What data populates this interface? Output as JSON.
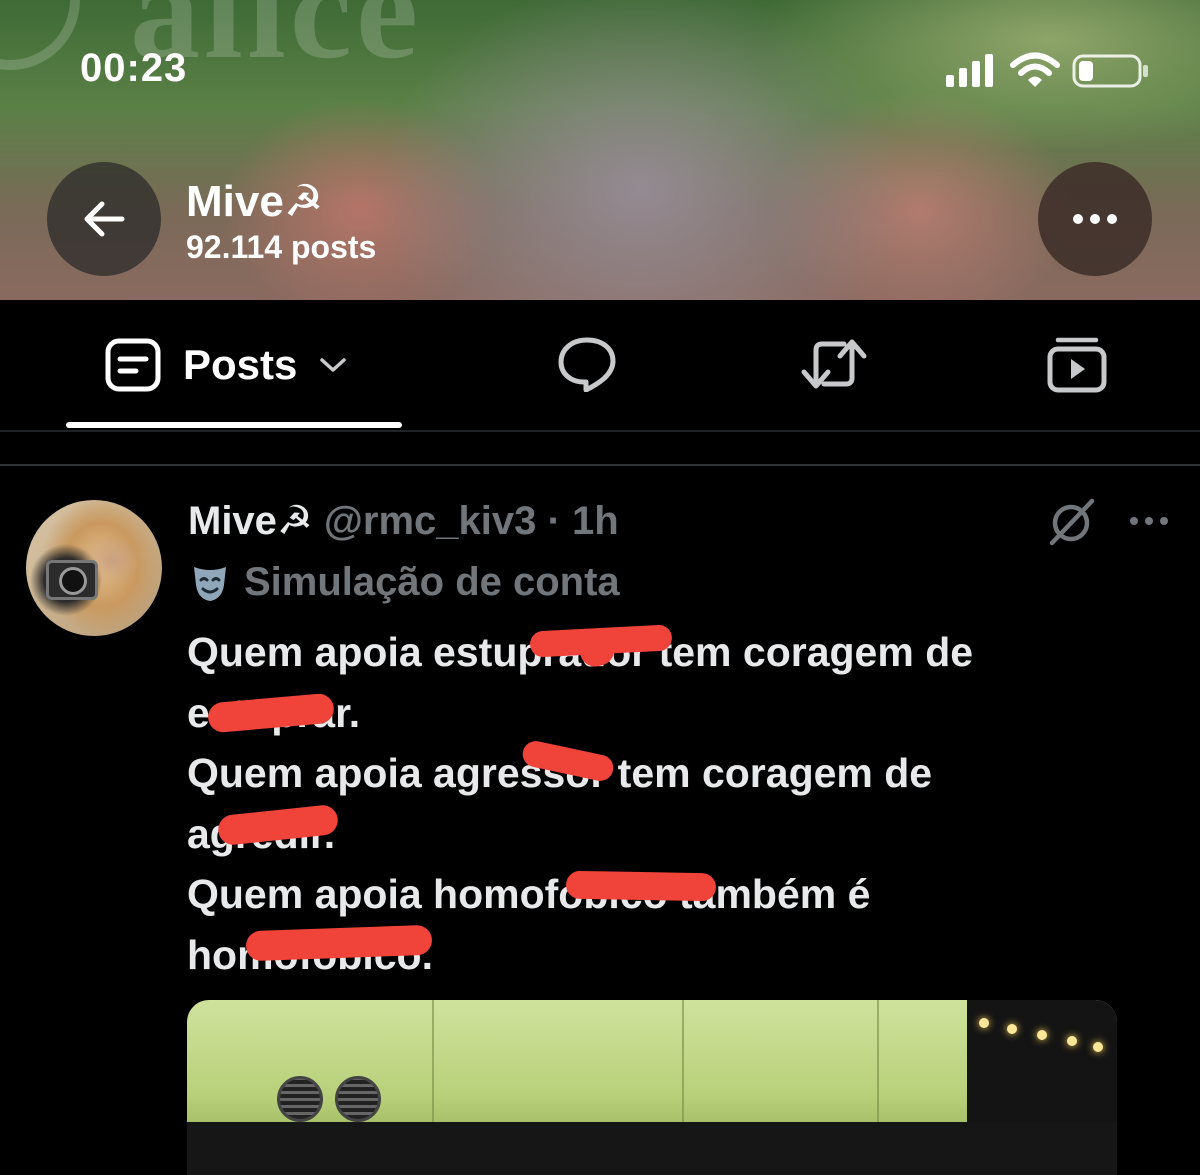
{
  "status_bar": {
    "time": "00:23"
  },
  "banner": {
    "watermark": "alice"
  },
  "profile": {
    "name": "Mive☭",
    "posts_count": "92.114 posts"
  },
  "tabs": [
    {
      "label": "Posts",
      "icon": "posts-icon",
      "selected": true
    },
    {
      "icon": "reply-bubble-icon"
    },
    {
      "icon": "repost-icon"
    },
    {
      "icon": "media-icon"
    }
  ],
  "post": {
    "display_name": "Mive☭",
    "handle_and_time": "@rmc_kiv3 · 1h",
    "label_icon": "theater-mask-icon",
    "label": "Simulação de conta",
    "lines": [
      "Quem apoia estuprador tem coragem de",
      "estuprar.",
      "Quem apoia agressor tem coragem de",
      "agredir.",
      "Quem apoia homofóbico também é",
      "homofóbico."
    ]
  },
  "colors": {
    "accent_red": "#f0433a",
    "muted": "#71767b",
    "text": "#e7e9ea",
    "background": "#000000"
  }
}
